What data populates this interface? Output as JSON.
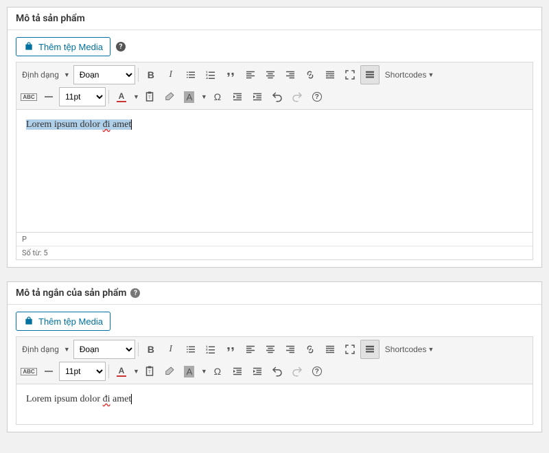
{
  "panels": [
    {
      "title": "Mô tả sản phẩm",
      "media_btn": "Thêm tệp Media",
      "format_label": "Định dạng",
      "format_selected": "Đoạn",
      "font_size": "11pt",
      "shortcodes_label": "Shortcodes",
      "content_plain": "Lorem ipsum dolor ",
      "content_wavy": "đi",
      "content_rest": " amet",
      "footer_p": "P",
      "footer_wc": "Số từ: 5"
    },
    {
      "title": "Mô tả ngắn của sản phẩm",
      "media_btn": "Thêm tệp Media",
      "format_label": "Định dạng",
      "format_selected": "Đoạn",
      "font_size": "11pt",
      "shortcodes_label": "Shortcodes",
      "content_plain": "Lorem ipsum dolor ",
      "content_wavy": "đi",
      "content_rest": " amet"
    }
  ]
}
